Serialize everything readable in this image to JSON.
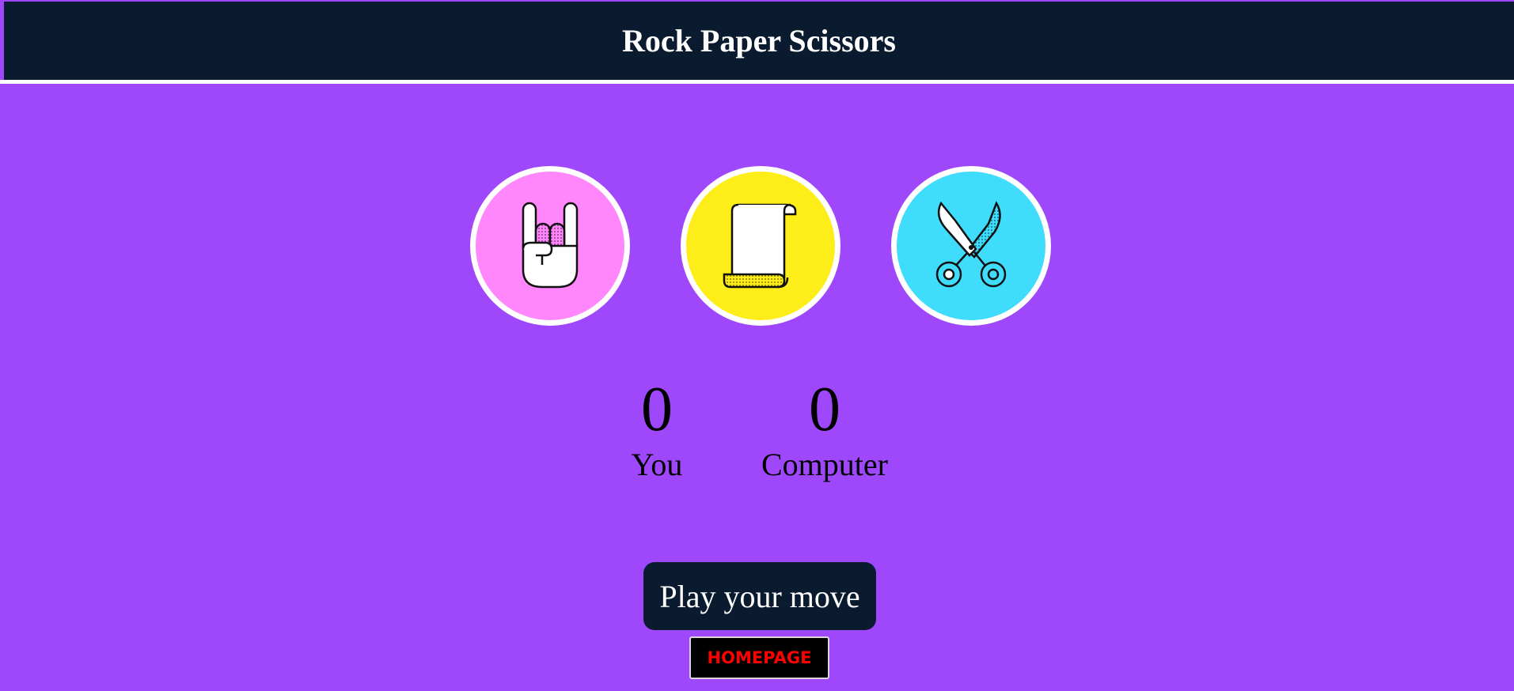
{
  "header": {
    "title": "Rock Paper Scissors"
  },
  "choices": [
    {
      "name": "rock",
      "icon": "rock-hand-icon",
      "color": "#ff86fb"
    },
    {
      "name": "paper",
      "icon": "paper-scroll-icon",
      "color": "#fded19"
    },
    {
      "name": "scissors",
      "icon": "scissors-icon",
      "color": "#3fdcfb"
    }
  ],
  "scores": {
    "user": {
      "value": "0",
      "label": "You"
    },
    "computer": {
      "value": "0",
      "label": "Computer"
    }
  },
  "message": "Play your move",
  "homepage_button": "HOMEPAGE",
  "colors": {
    "background": "#9f47fb",
    "header": "#0a1b30",
    "home_text": "#ff0000"
  }
}
